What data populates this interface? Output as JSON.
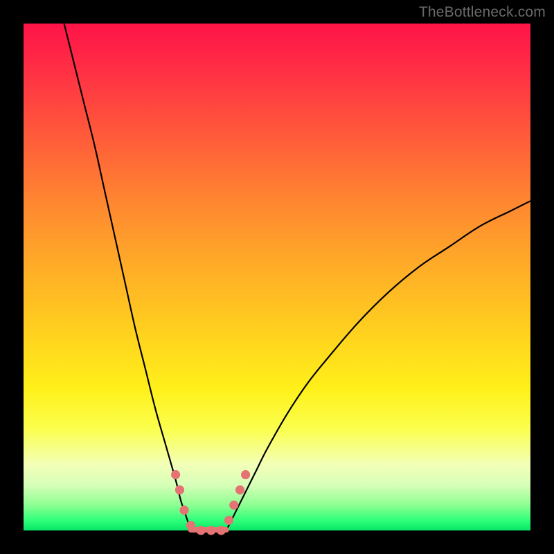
{
  "watermark": "TheBottleneck.com",
  "colors": {
    "frame": "#000000",
    "curve": "#000000",
    "marks": "#e57373",
    "gradient_top": "#ff1448",
    "gradient_bottom": "#08e566"
  },
  "chart_data": {
    "type": "line",
    "title": "",
    "xlabel": "",
    "ylabel": "",
    "xlim": [
      0,
      100
    ],
    "ylim": [
      0,
      100
    ],
    "note": "Axes are unlabeled in the source image; x and y are normalized 0–100. Two monotone curves descend into a shared valley near x≈33–40 at y≈0, then the right curve rises. Values are read off the rendered pixels.",
    "series": [
      {
        "name": "left-curve",
        "x": [
          8,
          10,
          12,
          14,
          16,
          18,
          20,
          22,
          24,
          26,
          28,
          30,
          31,
          32,
          33
        ],
        "y": [
          100,
          92,
          84,
          76,
          67,
          58,
          49,
          40,
          32,
          24,
          17,
          10,
          6,
          3,
          0
        ]
      },
      {
        "name": "right-curve",
        "x": [
          40,
          42,
          44,
          46,
          48,
          52,
          56,
          60,
          66,
          72,
          78,
          84,
          90,
          96,
          100
        ],
        "y": [
          0,
          4,
          8,
          12,
          16,
          23,
          29,
          34,
          41,
          47,
          52,
          56,
          60,
          63,
          65
        ]
      }
    ],
    "valley_segment": {
      "x_start": 33,
      "x_end": 40,
      "y": 0
    },
    "markers": {
      "name": "sample-dots",
      "points": [
        {
          "x": 30.0,
          "y": 11
        },
        {
          "x": 30.8,
          "y": 8
        },
        {
          "x": 31.7,
          "y": 4
        },
        {
          "x": 33.0,
          "y": 1
        },
        {
          "x": 35.0,
          "y": 0
        },
        {
          "x": 37.0,
          "y": 0
        },
        {
          "x": 39.0,
          "y": 0
        },
        {
          "x": 40.5,
          "y": 2
        },
        {
          "x": 41.5,
          "y": 5
        },
        {
          "x": 42.7,
          "y": 8
        },
        {
          "x": 43.8,
          "y": 11
        }
      ],
      "radius_pct": 0.9
    }
  }
}
